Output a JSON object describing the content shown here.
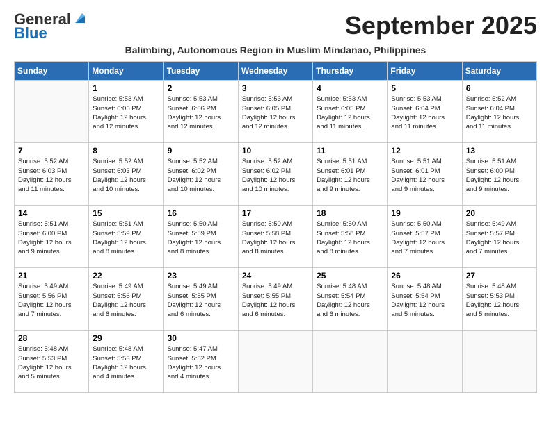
{
  "logo": {
    "general": "General",
    "blue": "Blue"
  },
  "header": {
    "month_title": "September 2025",
    "subtitle": "Balimbing, Autonomous Region in Muslim Mindanao, Philippines"
  },
  "weekdays": [
    "Sunday",
    "Monday",
    "Tuesday",
    "Wednesday",
    "Thursday",
    "Friday",
    "Saturday"
  ],
  "weeks": [
    [
      {
        "day": "",
        "info": ""
      },
      {
        "day": "1",
        "info": "Sunrise: 5:53 AM\nSunset: 6:06 PM\nDaylight: 12 hours\nand 12 minutes."
      },
      {
        "day": "2",
        "info": "Sunrise: 5:53 AM\nSunset: 6:06 PM\nDaylight: 12 hours\nand 12 minutes."
      },
      {
        "day": "3",
        "info": "Sunrise: 5:53 AM\nSunset: 6:05 PM\nDaylight: 12 hours\nand 12 minutes."
      },
      {
        "day": "4",
        "info": "Sunrise: 5:53 AM\nSunset: 6:05 PM\nDaylight: 12 hours\nand 11 minutes."
      },
      {
        "day": "5",
        "info": "Sunrise: 5:53 AM\nSunset: 6:04 PM\nDaylight: 12 hours\nand 11 minutes."
      },
      {
        "day": "6",
        "info": "Sunrise: 5:52 AM\nSunset: 6:04 PM\nDaylight: 12 hours\nand 11 minutes."
      }
    ],
    [
      {
        "day": "7",
        "info": "Sunrise: 5:52 AM\nSunset: 6:03 PM\nDaylight: 12 hours\nand 11 minutes."
      },
      {
        "day": "8",
        "info": "Sunrise: 5:52 AM\nSunset: 6:03 PM\nDaylight: 12 hours\nand 10 minutes."
      },
      {
        "day": "9",
        "info": "Sunrise: 5:52 AM\nSunset: 6:02 PM\nDaylight: 12 hours\nand 10 minutes."
      },
      {
        "day": "10",
        "info": "Sunrise: 5:52 AM\nSunset: 6:02 PM\nDaylight: 12 hours\nand 10 minutes."
      },
      {
        "day": "11",
        "info": "Sunrise: 5:51 AM\nSunset: 6:01 PM\nDaylight: 12 hours\nand 9 minutes."
      },
      {
        "day": "12",
        "info": "Sunrise: 5:51 AM\nSunset: 6:01 PM\nDaylight: 12 hours\nand 9 minutes."
      },
      {
        "day": "13",
        "info": "Sunrise: 5:51 AM\nSunset: 6:00 PM\nDaylight: 12 hours\nand 9 minutes."
      }
    ],
    [
      {
        "day": "14",
        "info": "Sunrise: 5:51 AM\nSunset: 6:00 PM\nDaylight: 12 hours\nand 9 minutes."
      },
      {
        "day": "15",
        "info": "Sunrise: 5:51 AM\nSunset: 5:59 PM\nDaylight: 12 hours\nand 8 minutes."
      },
      {
        "day": "16",
        "info": "Sunrise: 5:50 AM\nSunset: 5:59 PM\nDaylight: 12 hours\nand 8 minutes."
      },
      {
        "day": "17",
        "info": "Sunrise: 5:50 AM\nSunset: 5:58 PM\nDaylight: 12 hours\nand 8 minutes."
      },
      {
        "day": "18",
        "info": "Sunrise: 5:50 AM\nSunset: 5:58 PM\nDaylight: 12 hours\nand 8 minutes."
      },
      {
        "day": "19",
        "info": "Sunrise: 5:50 AM\nSunset: 5:57 PM\nDaylight: 12 hours\nand 7 minutes."
      },
      {
        "day": "20",
        "info": "Sunrise: 5:49 AM\nSunset: 5:57 PM\nDaylight: 12 hours\nand 7 minutes."
      }
    ],
    [
      {
        "day": "21",
        "info": "Sunrise: 5:49 AM\nSunset: 5:56 PM\nDaylight: 12 hours\nand 7 minutes."
      },
      {
        "day": "22",
        "info": "Sunrise: 5:49 AM\nSunset: 5:56 PM\nDaylight: 12 hours\nand 6 minutes."
      },
      {
        "day": "23",
        "info": "Sunrise: 5:49 AM\nSunset: 5:55 PM\nDaylight: 12 hours\nand 6 minutes."
      },
      {
        "day": "24",
        "info": "Sunrise: 5:49 AM\nSunset: 5:55 PM\nDaylight: 12 hours\nand 6 minutes."
      },
      {
        "day": "25",
        "info": "Sunrise: 5:48 AM\nSunset: 5:54 PM\nDaylight: 12 hours\nand 6 minutes."
      },
      {
        "day": "26",
        "info": "Sunrise: 5:48 AM\nSunset: 5:54 PM\nDaylight: 12 hours\nand 5 minutes."
      },
      {
        "day": "27",
        "info": "Sunrise: 5:48 AM\nSunset: 5:53 PM\nDaylight: 12 hours\nand 5 minutes."
      }
    ],
    [
      {
        "day": "28",
        "info": "Sunrise: 5:48 AM\nSunset: 5:53 PM\nDaylight: 12 hours\nand 5 minutes."
      },
      {
        "day": "29",
        "info": "Sunrise: 5:48 AM\nSunset: 5:53 PM\nDaylight: 12 hours\nand 4 minutes."
      },
      {
        "day": "30",
        "info": "Sunrise: 5:47 AM\nSunset: 5:52 PM\nDaylight: 12 hours\nand 4 minutes."
      },
      {
        "day": "",
        "info": ""
      },
      {
        "day": "",
        "info": ""
      },
      {
        "day": "",
        "info": ""
      },
      {
        "day": "",
        "info": ""
      }
    ]
  ]
}
